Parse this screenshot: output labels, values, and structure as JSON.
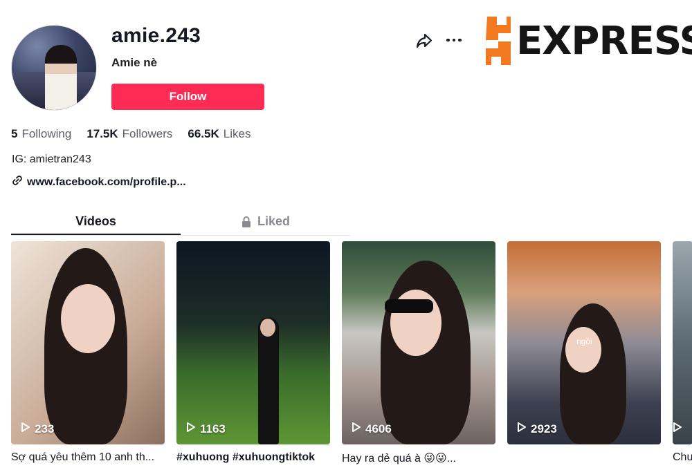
{
  "profile": {
    "username": "amie.243",
    "nickname": "Amie nè",
    "follow_label": "Follow",
    "bio": "IG: amietran243",
    "link": "www.facebook.com/profile.p..."
  },
  "stats": [
    {
      "value": "5",
      "label": "Following"
    },
    {
      "value": "17.5K",
      "label": "Followers"
    },
    {
      "value": "66.5K",
      "label": "Likes"
    }
  ],
  "watermark": {
    "text": "EXPRESS"
  },
  "tabs": [
    {
      "label": "Videos",
      "active": true
    },
    {
      "label": "Liked",
      "active": false,
      "icon": "lock-icon"
    }
  ],
  "videos": [
    {
      "views": "233",
      "caption": "Sợ quá yêu thêm 10 anh th..."
    },
    {
      "views": "1163",
      "caption": "#xuhuong #xuhuongtiktok"
    },
    {
      "views": "4606",
      "caption": "Hay ra dẻ quá à 😜😜..."
    },
    {
      "views": "2923",
      "caption": "",
      "overlay_text": "ngồi"
    },
    {
      "views": "",
      "caption": "Chu"
    }
  ],
  "colors": {
    "accent": "#fe2c55",
    "text": "#161823",
    "muted": "#8a8b91"
  }
}
